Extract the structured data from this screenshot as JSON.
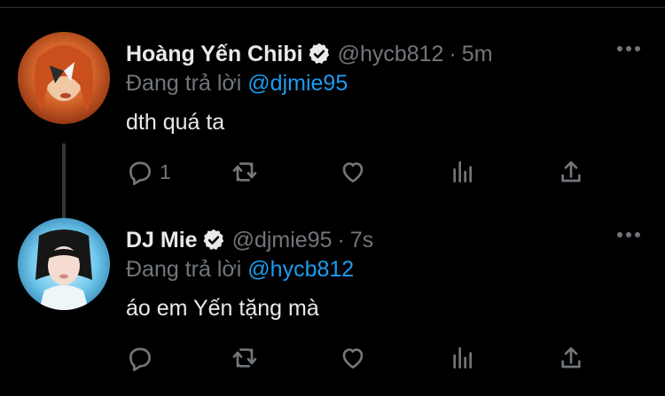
{
  "tweets": [
    {
      "author_name": "Hoàng Yến Chibi",
      "verified": true,
      "handle": "@hycb812",
      "separator": "·",
      "time": "5m",
      "replying_prefix": "Đang trả lời",
      "replying_to": "@djmie95",
      "text": "dth quá ta",
      "reply_count": "1",
      "avatar_icon": "avatar-portrait-orange",
      "thread_continues": true
    },
    {
      "author_name": "DJ Mie",
      "verified": true,
      "handle": "@djmie95",
      "separator": "·",
      "time": "7s",
      "replying_prefix": "Đang trả lời",
      "replying_to": "@hycb812",
      "text": "áo em Yến tặng mà",
      "reply_count": "",
      "avatar_icon": "avatar-portrait-blue",
      "thread_continues": false
    }
  ],
  "colors": {
    "background": "#000000",
    "text_primary": "#e7e9ea",
    "text_secondary": "#71767b",
    "link": "#1d9bf0"
  },
  "icons": {
    "reply": "reply-icon",
    "retweet": "retweet-icon",
    "like": "like-icon",
    "views": "views-icon",
    "share": "share-icon",
    "more": "more-icon",
    "verified": "verified-badge-icon"
  }
}
